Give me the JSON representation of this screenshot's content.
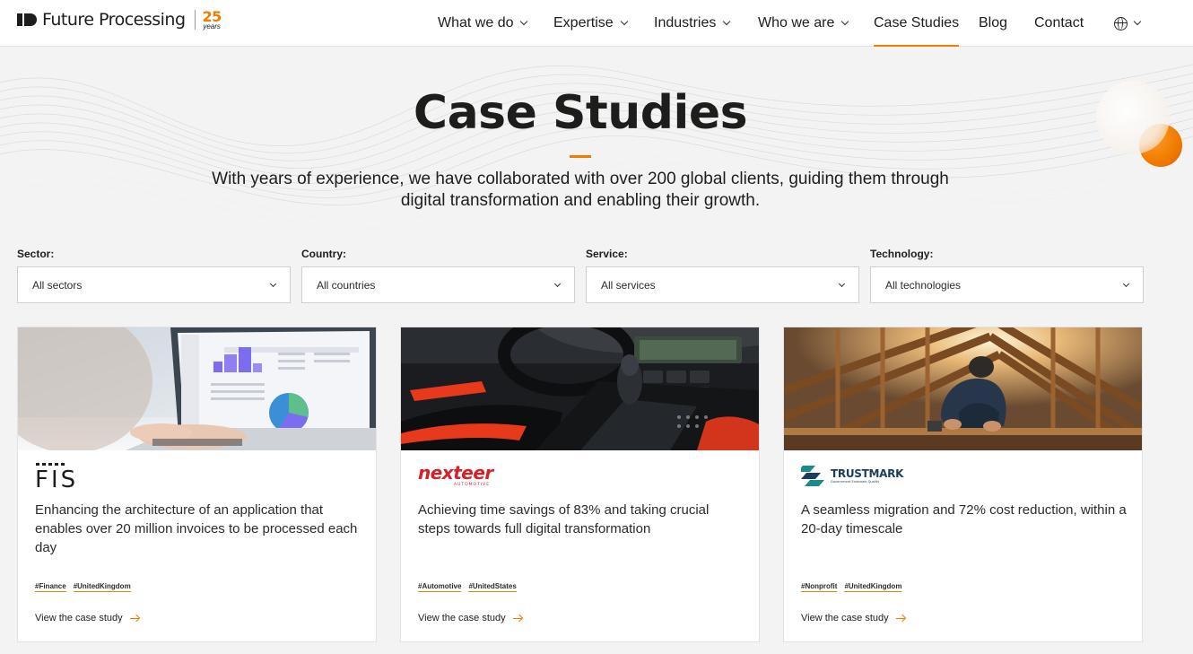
{
  "brand": {
    "name": "Future Processing",
    "years_number": "25",
    "years_label": "years"
  },
  "nav": {
    "items": [
      {
        "label": "What we do",
        "dropdown": true
      },
      {
        "label": "Expertise",
        "dropdown": true
      },
      {
        "label": "Industries",
        "dropdown": true
      },
      {
        "label": "Who we are",
        "dropdown": true
      },
      {
        "label": "Case Studies",
        "dropdown": false,
        "active": true
      },
      {
        "label": "Blog",
        "dropdown": false
      },
      {
        "label": "Contact",
        "dropdown": false
      }
    ],
    "language_icon": "globe-icon"
  },
  "hero": {
    "title": "Case Studies",
    "subtitle_line1": "With years of experience, we have collaborated with over 200 global clients, guiding them through",
    "subtitle_line2": "digital transformation and enabling their growth."
  },
  "filters": [
    {
      "label": "Sector:",
      "value": "All sectors"
    },
    {
      "label": "Country:",
      "value": "All countries"
    },
    {
      "label": "Service:",
      "value": "All services"
    },
    {
      "label": "Technology:",
      "value": "All technologies"
    }
  ],
  "cards": [
    {
      "logo": "FIS",
      "title": "Enhancing the architecture of an application that enables over 20 million invoices to be processed each day",
      "tags": [
        "#Finance",
        "#UnitedKingdom"
      ],
      "link": "View the case study"
    },
    {
      "logo": "nexteer",
      "logo_sub": "AUTOMOTIVE",
      "title": "Achieving time savings of 83% and taking crucial steps towards full digital transformation",
      "tags": [
        "#Automotive",
        "#UnitedStates"
      ],
      "link": "View the case study"
    },
    {
      "logo": "TRUSTMARK",
      "logo_sub": "Government Endorsed Quality",
      "title": "A seamless migration and 72% cost reduction, within a 20-day timescale",
      "tags": [
        "#Nonprofit",
        "#UnitedKingdom"
      ],
      "link": "View the case study"
    }
  ],
  "colors": {
    "accent": "#f07d00",
    "text": "#1d1d1b",
    "background": "#f3f3f4",
    "nexteer_red": "#d62027",
    "trustmark_teal": "#1d8a8a",
    "trustmark_navy": "#1c3d5a"
  }
}
